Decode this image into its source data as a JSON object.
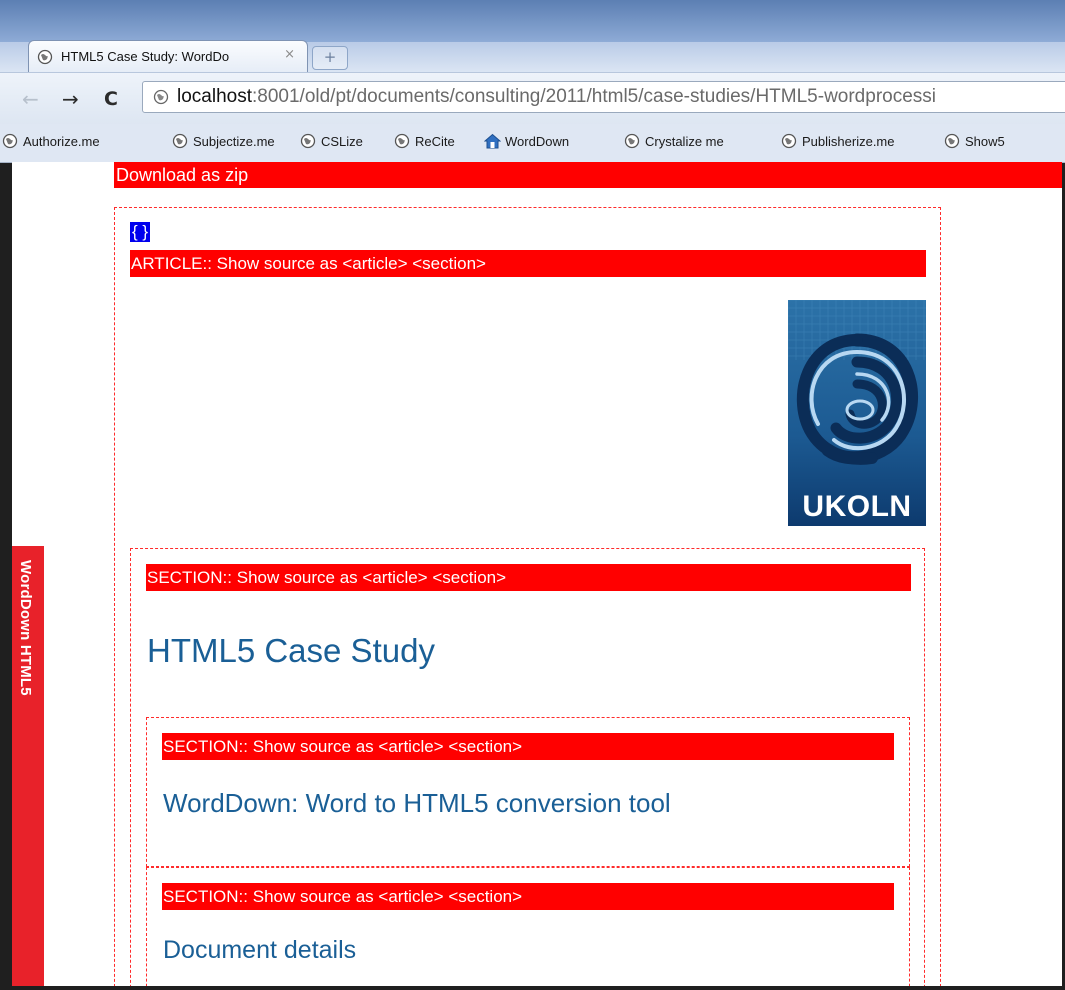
{
  "browser": {
    "tab_title": "HTML5 Case Study: WordDo",
    "tab_close_glyph": "×",
    "new_tab_glyph": "+",
    "back_glyph": "←",
    "forward_glyph": "→",
    "reload_glyph": "C",
    "url_host": "localhost",
    "url_rest": ":8001/old/pt/documents/consulting/2011/html5/case-studies/HTML5-wordprocessi",
    "bookmarks": [
      {
        "label": "Authorize.me",
        "icon": "globe-icon"
      },
      {
        "label": "Subjectize.me",
        "icon": "globe-icon"
      },
      {
        "label": "CSLize",
        "icon": "globe-icon"
      },
      {
        "label": "ReCite",
        "icon": "globe-icon"
      },
      {
        "label": "WordDown",
        "icon": "house-icon"
      },
      {
        "label": "Crystalize me",
        "icon": "globe-icon"
      },
      {
        "label": "Publisherize.me",
        "icon": "globe-icon"
      },
      {
        "label": "Show5",
        "icon": "globe-icon"
      }
    ]
  },
  "page": {
    "download_label": "Download as zip",
    "toggle_brace": "{ }",
    "article_bar": "ARTICLE:: Show source as <article> <section>",
    "section_bar": "SECTION:: Show source as <article> <section>",
    "heading_main": "HTML5 Case Study",
    "heading_sub": "WordDown: Word to HTML5 conversion tool",
    "heading_details": "Document details",
    "sidebar_tab": "WordDown HTML5",
    "logo_text": "UKOLN"
  },
  "colors": {
    "red_bar": "#ff0000",
    "side_tab": "#e8222a",
    "heading": "#1a5f96",
    "dashed_border": "#ff2b2b",
    "toggle_blue": "#0000ee"
  }
}
